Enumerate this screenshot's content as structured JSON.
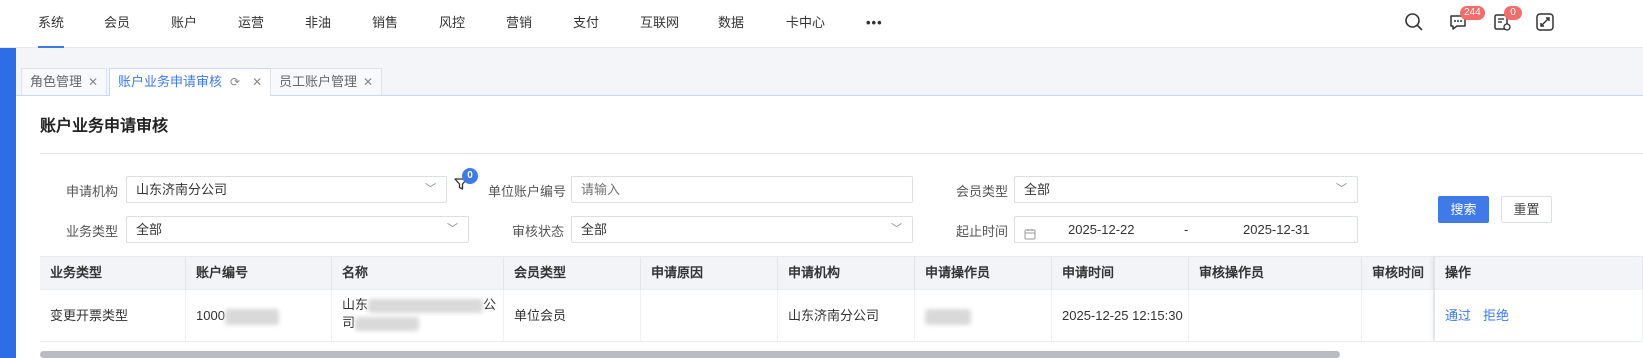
{
  "nav": {
    "items": [
      "系统",
      "会员",
      "账户",
      "运营",
      "非油",
      "销售",
      "风控",
      "营销",
      "支付",
      "互联网",
      "数据",
      "卡中心"
    ],
    "more": "•••",
    "active_index": 0
  },
  "tools": {
    "messages_badge": "244",
    "tasks_badge": "0"
  },
  "tabs": [
    {
      "label": "角色管理",
      "active": false
    },
    {
      "label": "账户业务申请审核",
      "active": true
    },
    {
      "label": "员工账户管理",
      "active": false
    }
  ],
  "page": {
    "title": "账户业务申请审核"
  },
  "filters": {
    "org_label": "申请机构",
    "org_value": "山东济南分公司",
    "filter_badge": "0",
    "unit_account_label": "单位账户编号",
    "unit_account_placeholder": "请输入",
    "member_type_label": "会员类型",
    "member_type_value": "全部",
    "biz_type_label": "业务类型",
    "biz_type_value": "全部",
    "audit_status_label": "审核状态",
    "audit_status_value": "全部",
    "date_label": "起止时间",
    "date_start": "2025-12-22",
    "date_sep": "-",
    "date_end": "2025-12-31",
    "search_label": "搜索",
    "reset_label": "重置"
  },
  "table": {
    "headers": [
      "业务类型",
      "账户编号",
      "名称",
      "会员类型",
      "申请原因",
      "申请机构",
      "申请操作员",
      "申请时间",
      "审核操作员",
      "审核时间",
      "操作"
    ],
    "rows": [
      {
        "biz_type": "变更开票类型",
        "account_no": "1000",
        "name_part1": "山东",
        "name_part2": "公",
        "name_part3": "司",
        "member_type": "单位会员",
        "reason": "",
        "org": "山东济南分公司",
        "operator": "",
        "apply_time": "2025-12-25 12:15:30",
        "auditor": "",
        "audit_time": "",
        "approve": "通过",
        "reject": "拒绝"
      }
    ]
  },
  "colors": {
    "accent": "#3f7ae6",
    "badge": "#f56c6c"
  },
  "icons": [
    "search-icon",
    "message-icon",
    "task-icon",
    "fullscreen-icon",
    "filter-icon",
    "calendar-icon",
    "refresh-icon",
    "close-icon",
    "chevron-down-icon"
  ]
}
